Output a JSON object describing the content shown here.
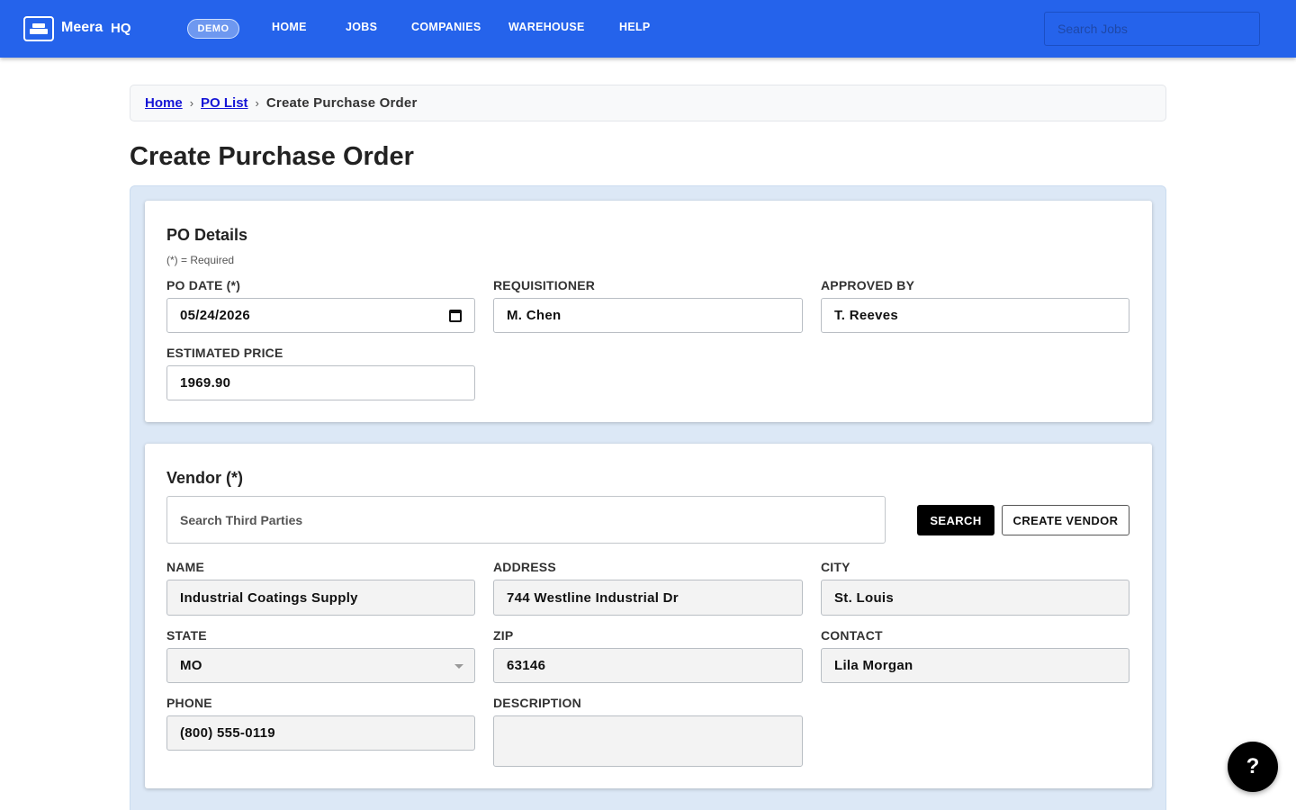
{
  "nav": {
    "brand": "Meera",
    "brand_suffix": "HQ",
    "demo_badge": "DEMO",
    "links": [
      "HOME",
      "JOBS",
      "COMPANIES",
      "WAREHOUSE",
      "HELP"
    ],
    "search_placeholder": "Search Jobs"
  },
  "breadcrumb": {
    "home": "Home",
    "sep": "›",
    "po_list": "PO List",
    "current": "Create Purchase Order"
  },
  "page_title": "Create Purchase Order",
  "po_details": {
    "title": "PO Details",
    "required_note": "(*) = Required",
    "po_date_label": "PO DATE (*)",
    "po_date_value": "05/24/2026",
    "requisitioner_label": "REQUISITIONER",
    "requisitioner_value": "M. Chen",
    "approved_by_label": "APPROVED BY",
    "approved_by_value": "T. Reeves",
    "estimated_price_label": "ESTIMATED PRICE",
    "estimated_price_value": "1969.90"
  },
  "vendor": {
    "title": "Vendor (*)",
    "search_placeholder": "Search Third Parties",
    "search_button": "SEARCH",
    "create_button": "CREATE VENDOR",
    "name_label": "NAME",
    "name_value": "Industrial Coatings Supply",
    "address_label": "ADDRESS",
    "address_value": "744 Westline Industrial Dr",
    "city_label": "CITY",
    "city_value": "St. Louis",
    "state_label": "STATE",
    "state_value": "MO",
    "zip_label": "ZIP",
    "zip_value": "63146",
    "contact_label": "CONTACT",
    "contact_value": "Lila Morgan",
    "phone_label": "PHONE",
    "phone_value": "(800) 555-0119",
    "description_label": "DESCRIPTION",
    "description_value": ""
  },
  "help_fab": "?",
  "colors": {
    "nav_bg": "#2563eb",
    "container_bg": "#dce8f6",
    "link": "#1515d6"
  }
}
